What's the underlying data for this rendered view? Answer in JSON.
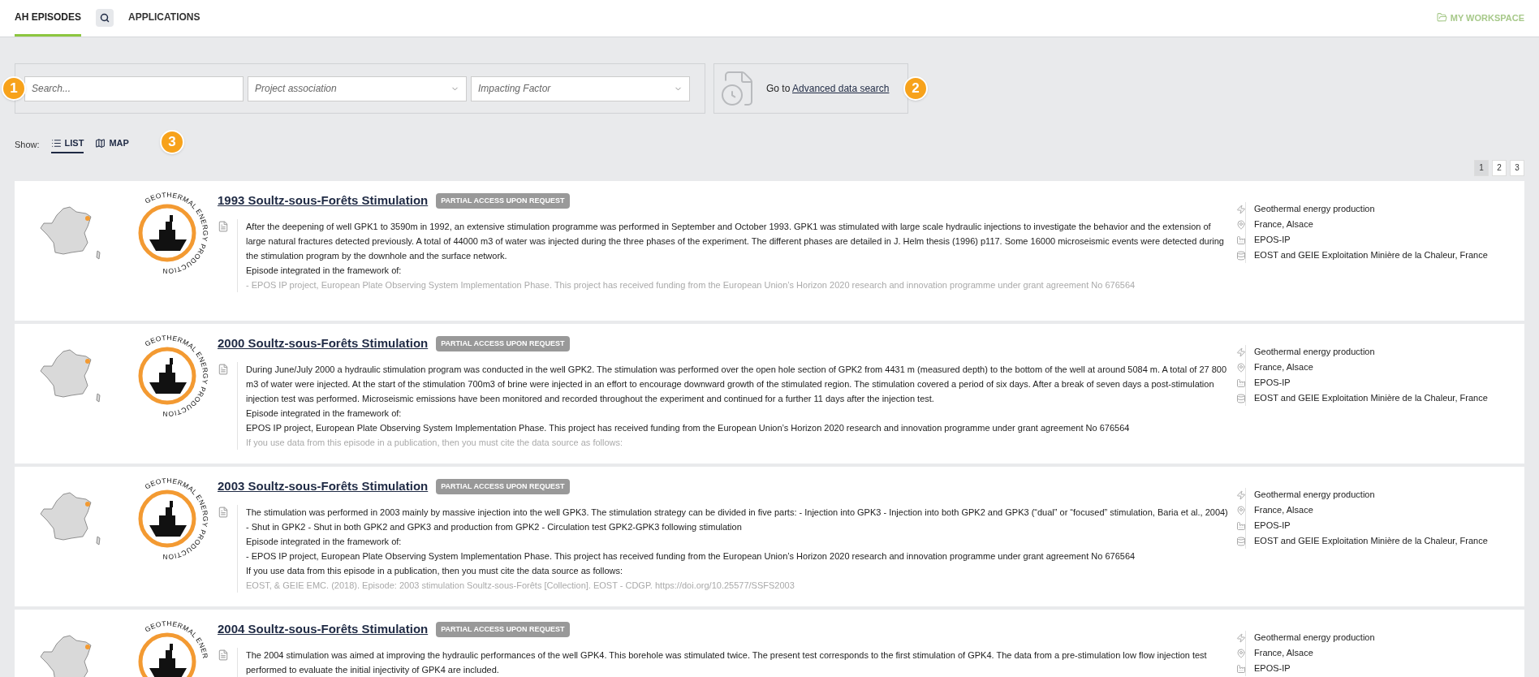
{
  "nav": {
    "tabs": [
      {
        "label": "AH EPISODES",
        "selected": true
      },
      {
        "label": "APPLICATIONS",
        "selected": false
      }
    ],
    "workspace": {
      "label": "MY WORKSPACE",
      "disabled": true
    }
  },
  "filters": {
    "search": {
      "placeholder": "Search..."
    },
    "selects": [
      {
        "placeholder": "Project association"
      },
      {
        "placeholder": "Impacting Factor"
      }
    ]
  },
  "advanced": {
    "prefix": "Go to",
    "link": "Advanced data search"
  },
  "markers": [
    "1",
    "2",
    "3"
  ],
  "view": {
    "label": "Show:",
    "options": [
      {
        "kind": "list",
        "label": "LIST",
        "selected": true
      },
      {
        "kind": "map",
        "label": "MAP",
        "selected": false
      }
    ]
  },
  "pagination": [
    {
      "label": "1",
      "selected": true
    },
    {
      "label": "2",
      "selected": false
    },
    {
      "label": "3",
      "selected": false
    }
  ],
  "episodes": [
    {
      "title": "1993 Soultz-sous-Forêts Stimulation",
      "access": "PARTIAL ACCESS UPON REQUEST",
      "logo_text": "GEOTHERMAL ENERGY PRODUCTION",
      "description": [
        "After the deepening of well GPK1 to 3590m in 1992, an extensive stimulation programme was performed in September and October 1993. GPK1 was stimulated with large scale hydraulic injections to investigate the behavior and the extension of large natural fractures detected previously. A total of 44000 m3 of water was injected during the three phases of the experiment. The different phases are detailed in J. Helm thesis (1996) p117. Some 16000 microseismic events were detected during the stimulation program by the downhole and the surface network.",
        "Episode integrated in the framework of:",
        "- EPOS IP project, European Plate Observing System Implementation Phase. This project has received funding from the European Union’s Horizon 2020 research and innovation programme under grant agreement No 676564"
      ],
      "meta": [
        {
          "kind": "sector",
          "text": "Geothermal energy production"
        },
        {
          "kind": "location",
          "text": "France, Alsace"
        },
        {
          "kind": "project",
          "text": "EPOS-IP"
        },
        {
          "kind": "provider",
          "text": "EOST and GEIE Exploitation Minière de la Chaleur, France"
        }
      ]
    },
    {
      "title": "2000 Soultz-sous-Forêts Stimulation",
      "access": "PARTIAL ACCESS UPON REQUEST",
      "logo_text": "GEOTHERMAL ENERGY PRODUCTION",
      "description": [
        "During June/July 2000 a hydraulic stimulation program was conducted in the well GPK2. The stimulation was performed over the open hole section of GPK2 from 4431 m (measured depth) to the bottom of the well at around 5084 m. A total of 27 800 m3 of water were injected. At the start of the stimulation 700m3 of brine were injected in an effort to encourage downward growth of the stimulated region. The stimulation covered a period of six days. After a break of seven days a post-stimulation injection test was performed. Microseismic emissions have been monitored and recorded throughout the experiment and continued for a further 11 days after the injection test.",
        "Episode integrated in the framework of:",
        "EPOS IP project, European Plate Observing System Implementation Phase. This project has received funding from the European Union’s Horizon 2020 research and innovation programme under grant agreement No 676564",
        "If you use data from this episode in a publication, then you must cite the data source as follows:"
      ],
      "meta": [
        {
          "kind": "sector",
          "text": "Geothermal energy production"
        },
        {
          "kind": "location",
          "text": "France, Alsace"
        },
        {
          "kind": "project",
          "text": "EPOS-IP"
        },
        {
          "kind": "provider",
          "text": "EOST and GEIE Exploitation Minière de la Chaleur, France"
        }
      ]
    },
    {
      "title": "2003 Soultz-sous-Forêts Stimulation",
      "access": "PARTIAL ACCESS UPON REQUEST",
      "logo_text": "GEOTHERMAL ENERGY PRODUCTION",
      "description": [
        "The stimulation was performed in 2003 mainly by massive injection into the well GPK3. The stimulation strategy can be divided in five parts: - Injection into GPK3 - Injection into both GPK2 and GPK3 (“dual” or “focused” stimulation, Baria et al., 2004) - Shut in GPK2 - Shut in both GPK2 and GPK3 and production from GPK2 - Circulation test GPK2-GPK3 following stimulation",
        "Episode integrated in the framework of:",
        "- EPOS IP project, European Plate Observing System Implementation Phase. This project has received funding from the European Union’s Horizon 2020 research and innovation programme under grant agreement No 676564",
        "If you use data from this episode in a publication, then you must cite the data source as follows:",
        "EOST, & GEIE EMC. (2018). Episode: 2003 stimulation Soultz-sous-Forêts [Collection]. EOST - CDGP. https://doi.org/10.25577/SSFS2003"
      ],
      "meta": [
        {
          "kind": "sector",
          "text": "Geothermal energy production"
        },
        {
          "kind": "location",
          "text": "France, Alsace"
        },
        {
          "kind": "project",
          "text": "EPOS-IP"
        },
        {
          "kind": "provider",
          "text": "EOST and GEIE Exploitation Minière de la Chaleur, France"
        }
      ]
    },
    {
      "title": "2004 Soultz-sous-Forêts Stimulation",
      "access": "PARTIAL ACCESS UPON REQUEST",
      "logo_text": "GEOTHERMAL ENER",
      "description": [
        "The 2004 stimulation was aimed at improving the hydraulic performances of the well GPK4. This borehole was stimulated twice. The present test corresponds to the first stimulation of GPK4. The data from a pre-stimulation low flow injection test performed to evaluate the initial injectivity of GPK4 are included."
      ],
      "meta": [
        {
          "kind": "sector",
          "text": "Geothermal energy production"
        },
        {
          "kind": "location",
          "text": "France, Alsace"
        },
        {
          "kind": "project",
          "text": "EPOS-IP"
        }
      ]
    }
  ]
}
